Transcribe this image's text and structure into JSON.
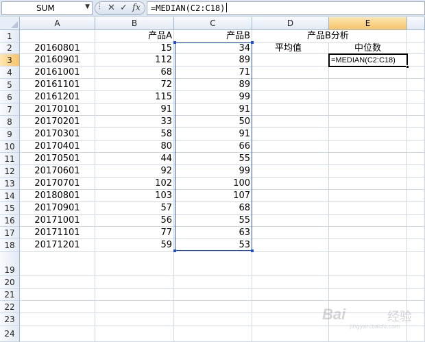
{
  "formula_bar": {
    "name_box": "SUM",
    "cancel_icon": "✕",
    "confirm_icon": "✓",
    "fx_label": "fx",
    "formula": "=MEDIAN(C2:C18)"
  },
  "columns": [
    "A",
    "B",
    "C",
    "D",
    "E"
  ],
  "active_cell": "E3",
  "rows": [
    {
      "n": "1",
      "A": "",
      "B": "产品A",
      "C": "产品B",
      "D": "产品B分析",
      "E": ""
    },
    {
      "n": "2",
      "A": "20160801",
      "B": "15",
      "C": "34",
      "D": "平均值",
      "E": "中位数"
    },
    {
      "n": "3",
      "A": "20160901",
      "B": "112",
      "C": "89",
      "D": "",
      "E": "=MEDIAN(C2:C18)"
    },
    {
      "n": "4",
      "A": "20161001",
      "B": "68",
      "C": "71",
      "D": "",
      "E": ""
    },
    {
      "n": "5",
      "A": "20161101",
      "B": "72",
      "C": "89",
      "D": "",
      "E": ""
    },
    {
      "n": "6",
      "A": "20161201",
      "B": "115",
      "C": "99",
      "D": "",
      "E": ""
    },
    {
      "n": "7",
      "A": "20170101",
      "B": "91",
      "C": "91",
      "D": "",
      "E": ""
    },
    {
      "n": "8",
      "A": "20170201",
      "B": "33",
      "C": "50",
      "D": "",
      "E": ""
    },
    {
      "n": "9",
      "A": "20170301",
      "B": "58",
      "C": "91",
      "D": "",
      "E": ""
    },
    {
      "n": "10",
      "A": "20170401",
      "B": "80",
      "C": "66",
      "D": "",
      "E": ""
    },
    {
      "n": "11",
      "A": "20170501",
      "B": "44",
      "C": "55",
      "D": "",
      "E": ""
    },
    {
      "n": "12",
      "A": "20170601",
      "B": "92",
      "C": "99",
      "D": "",
      "E": ""
    },
    {
      "n": "13",
      "A": "20170701",
      "B": "102",
      "C": "100",
      "D": "",
      "E": ""
    },
    {
      "n": "14",
      "A": "20180801",
      "B": "103",
      "C": "107",
      "D": "",
      "E": ""
    },
    {
      "n": "15",
      "A": "20170901",
      "B": "57",
      "C": "68",
      "D": "",
      "E": ""
    },
    {
      "n": "16",
      "A": "20171001",
      "B": "56",
      "C": "55",
      "D": "",
      "E": ""
    },
    {
      "n": "17",
      "A": "20171101",
      "B": "77",
      "C": "63",
      "D": "",
      "E": ""
    },
    {
      "n": "18",
      "A": "20171201",
      "B": "59",
      "C": "53",
      "D": "",
      "E": ""
    },
    {
      "n": "19",
      "A": "",
      "B": "",
      "C": "",
      "D": "",
      "E": ""
    },
    {
      "n": "20",
      "A": "",
      "B": "",
      "C": "",
      "D": "",
      "E": ""
    },
    {
      "n": "21",
      "A": "",
      "B": "",
      "C": "",
      "D": "",
      "E": ""
    },
    {
      "n": "22",
      "A": "",
      "B": "",
      "C": "",
      "D": "",
      "E": ""
    },
    {
      "n": "23",
      "A": "",
      "B": "",
      "C": "",
      "D": "",
      "E": ""
    },
    {
      "n": "24",
      "A": "",
      "B": "",
      "C": "",
      "D": "",
      "E": ""
    }
  ],
  "watermark": {
    "brand": "Bai",
    "suffix": "经验",
    "url": "jingyan.baidu.com"
  },
  "colors": {
    "selection": "#1f4fd6",
    "header_active": "#f8c36a"
  }
}
